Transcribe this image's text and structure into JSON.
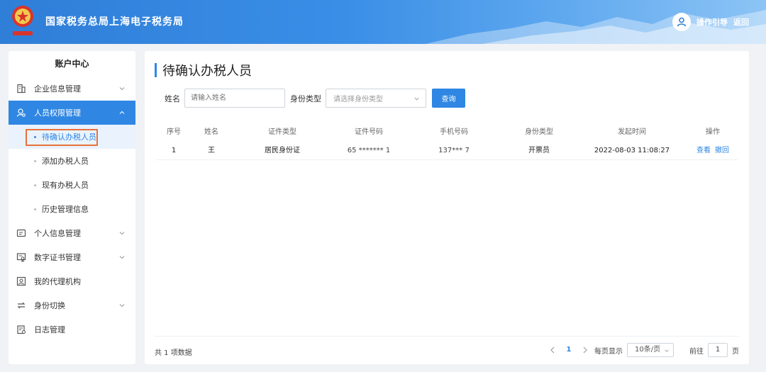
{
  "header": {
    "site_title": "国家税务总局上海电子税务局",
    "guide_link": "操作引导",
    "back_link": "返回"
  },
  "sidebar": {
    "title": "账户中心",
    "items": [
      {
        "label": "企业信息管理",
        "icon": "building-icon"
      },
      {
        "label": "人员权限管理",
        "icon": "user-search-icon"
      },
      {
        "label": "个人信息管理",
        "icon": "id-card-icon"
      },
      {
        "label": "数字证书管理",
        "icon": "certificate-icon"
      },
      {
        "label": "我的代理机构",
        "icon": "agency-icon"
      },
      {
        "label": "身份切换",
        "icon": "switch-icon"
      },
      {
        "label": "日志管理",
        "icon": "log-icon"
      }
    ],
    "sub_items": [
      {
        "label": "待确认办税人员"
      },
      {
        "label": "添加办税人员"
      },
      {
        "label": "现有办税人员"
      },
      {
        "label": "历史管理信息"
      }
    ]
  },
  "main": {
    "title": "待确认办税人员",
    "filters": {
      "name_label": "姓名",
      "name_placeholder": "请输入姓名",
      "id_type_label": "身份类型",
      "id_type_placeholder": "请选择身份类型",
      "query_button": "查询"
    },
    "table": {
      "columns": [
        "序号",
        "姓名",
        "证件类型",
        "证件号码",
        "手机号码",
        "身份类型",
        "发起时间",
        "操作"
      ],
      "rows": [
        {
          "index": "1",
          "name": "王",
          "id_type": "居民身份证",
          "id_number": "65     *******     1",
          "phone": "137***       7",
          "role": "开票员",
          "time": "2022-08-03 11:08:27",
          "view": "查看",
          "revoke": "撤回"
        }
      ]
    },
    "footer": {
      "total": "共 1 项数据",
      "current_page": "1",
      "per_page_label": "每页显示",
      "page_size": "10条/页",
      "goto_label": "前往",
      "goto_value": "1",
      "page_unit": "页"
    }
  },
  "colors": {
    "primary": "#2f87e3",
    "highlight": "#e8703a"
  }
}
